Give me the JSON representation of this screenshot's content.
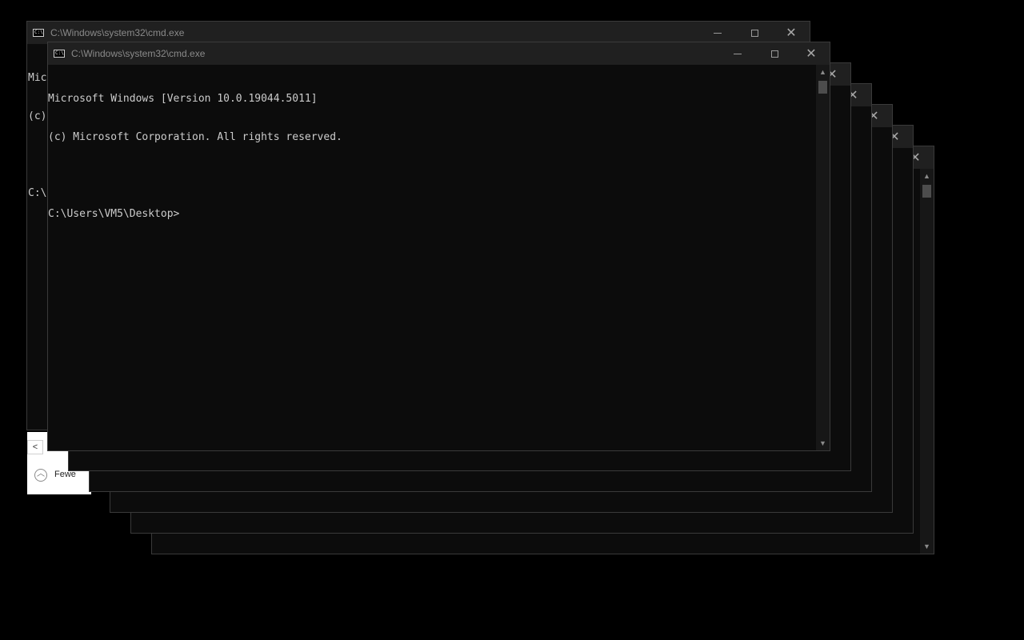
{
  "windows": {
    "title": "C:\\Windows\\system32\\cmd.exe",
    "console_lines": [
      "Microsoft Windows [Version 10.0.19044.5011]",
      "(c) Microsoft Corporation. All rights reserved.",
      "",
      "C:\\Users\\VM5\\Desktop>"
    ],
    "back_partial_lines": [
      "Mic",
      "(c)",
      "",
      "C:\\"
    ]
  },
  "background_dialog": {
    "back_arrow": "<",
    "fewer_label": "Fewe",
    "fewer_icon": "chevron-up-circle-icon"
  },
  "controls": {
    "minimize": "minimize-icon",
    "maximize": "maximize-icon",
    "close": "close-icon",
    "close_glyph": "✕"
  },
  "colors": {
    "desktop": "#000000",
    "console_bg": "#0c0c0c",
    "titlebar": "#202020",
    "text": "#cccccc"
  }
}
